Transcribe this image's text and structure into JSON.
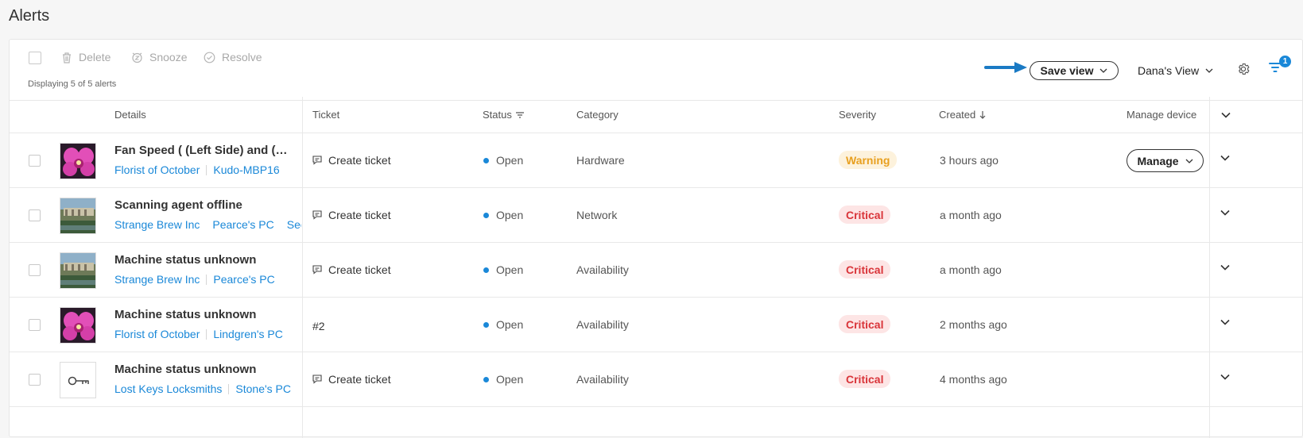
{
  "page": {
    "title": "Alerts"
  },
  "toolbar": {
    "delete_label": "Delete",
    "snooze_label": "Snooze",
    "resolve_label": "Resolve",
    "displaying": "Displaying 5 of 5 alerts",
    "save_view_label": "Save view",
    "view_name": "Dana's View",
    "filter_count": "1"
  },
  "columns": {
    "details": "Details",
    "ticket": "Ticket",
    "status": "Status",
    "category": "Category",
    "severity": "Severity",
    "created": "Created",
    "manage_device": "Manage device"
  },
  "rows": [
    {
      "title": "Fan Speed ( (Left Side) and (Right Side) )",
      "links": [
        "Florist of October",
        "Kudo-MBP16"
      ],
      "thumb": "orchid",
      "ticket": "Create ticket",
      "status": "Open",
      "category": "Hardware",
      "severity": "Warning",
      "created": "3 hours ago",
      "manage_label": "Manage"
    },
    {
      "title": "Scanning agent offline",
      "links": [
        "Strange Brew Inc",
        "Pearce's PC",
        "See"
      ],
      "thumb": "garden",
      "ticket": "Create ticket",
      "status": "Open",
      "category": "Network",
      "severity": "Critical",
      "created": "a month ago"
    },
    {
      "title": "Machine status unknown",
      "links": [
        "Strange Brew Inc",
        "Pearce's PC"
      ],
      "thumb": "garden",
      "ticket": "Create ticket",
      "status": "Open",
      "category": "Availability",
      "severity": "Critical",
      "created": "a month ago"
    },
    {
      "title": "Machine status unknown",
      "links": [
        "Florist of October",
        "Lindgren's PC"
      ],
      "thumb": "orchid",
      "ticket": "#2",
      "status": "Open",
      "category": "Availability",
      "severity": "Critical",
      "created": "2 months ago"
    },
    {
      "title": "Machine status unknown",
      "links": [
        "Lost Keys Locksmiths",
        "Stone's PC"
      ],
      "thumb": "key",
      "ticket": "Create ticket",
      "status": "Open",
      "category": "Availability",
      "severity": "Critical",
      "created": "4 months ago"
    }
  ],
  "colors": {
    "link": "#1a88d8",
    "warning_text": "#e8a020",
    "warning_bg": "#fdf2dc",
    "critical_text": "#d9353a",
    "critical_bg": "#fde5e5",
    "status_dot": "#1a88d8",
    "arrow": "#1a7ac4"
  }
}
